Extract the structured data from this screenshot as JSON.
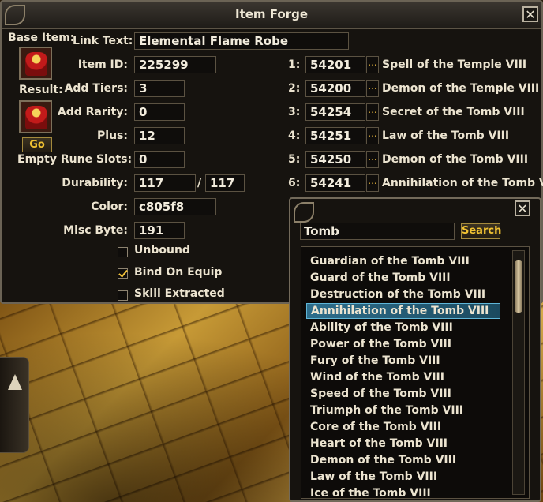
{
  "window": {
    "title": "Item Forge",
    "close_glyph": "✕"
  },
  "form": {
    "base_item_label": "Base Item:",
    "result_label": "Result:",
    "go_label": "Go",
    "link_text_label": "Link Text:",
    "link_text_value": "Elemental Flame Robe",
    "item_id_label": "Item ID:",
    "item_id_value": "225299",
    "add_tiers_label": "Add Tiers:",
    "add_tiers_value": "3",
    "add_rarity_label": "Add Rarity:",
    "add_rarity_value": "0",
    "plus_label": "Plus:",
    "plus_value": "12",
    "empty_rune_label": "Empty Rune Slots:",
    "empty_rune_value": "0",
    "durability_label": "Durability:",
    "durability_current": "117",
    "durability_sep": "/",
    "durability_max": "117",
    "color_label": "Color:",
    "color_value": "c805f8",
    "misc_byte_label": "Misc Byte:",
    "misc_byte_value": "191"
  },
  "checkboxes": [
    {
      "label": "Unbound",
      "checked": false
    },
    {
      "label": "Bind On Equip",
      "checked": true
    },
    {
      "label": "Skill Extracted",
      "checked": false
    }
  ],
  "runes": [
    {
      "index": "1:",
      "id": "54201",
      "button": "...",
      "name": "Spell of the Temple VIII"
    },
    {
      "index": "2:",
      "id": "54200",
      "button": "...",
      "name": "Demon of the Temple VIII"
    },
    {
      "index": "3:",
      "id": "54254",
      "button": "...",
      "name": "Secret of the Tomb VIII"
    },
    {
      "index": "4:",
      "id": "54251",
      "button": "...",
      "name": "Law of the Tomb VIII"
    },
    {
      "index": "5:",
      "id": "54250",
      "button": "...",
      "name": "Demon of the Tomb VIII"
    },
    {
      "index": "6:",
      "id": "54241",
      "button": "...",
      "name": "Annihilation of the Tomb VIII"
    }
  ],
  "search_popup": {
    "close_glyph": "✕",
    "query": "Tomb",
    "search_label": "Search",
    "selected_index": 3,
    "results": [
      "Guardian of the Tomb VIII",
      "Guard of the Tomb VIII",
      "Destruction of the Tomb VIII",
      "Annihilation of the Tomb VIII",
      "Ability of the Tomb VIII",
      "Power of the Tomb VIII",
      "Fury of the Tomb VIII",
      "Wind of the Tomb VIII",
      "Speed of the Tomb VIII",
      "Triumph of the Tomb VIII",
      "Core of the Tomb VIII",
      "Heart of the Tomb VIII",
      "Demon of the Tomb VIII",
      "Law of the Tomb VIII",
      "Ice of the Tomb VIII"
    ]
  },
  "colors": {
    "accent_gold": "#f1c232",
    "selection_blue": "#2e6e8c",
    "text": "#ece4d0"
  },
  "icons": {
    "base_item": "robe-icon",
    "result": "robe-icon",
    "side_handle": "chevron-up-icon"
  }
}
